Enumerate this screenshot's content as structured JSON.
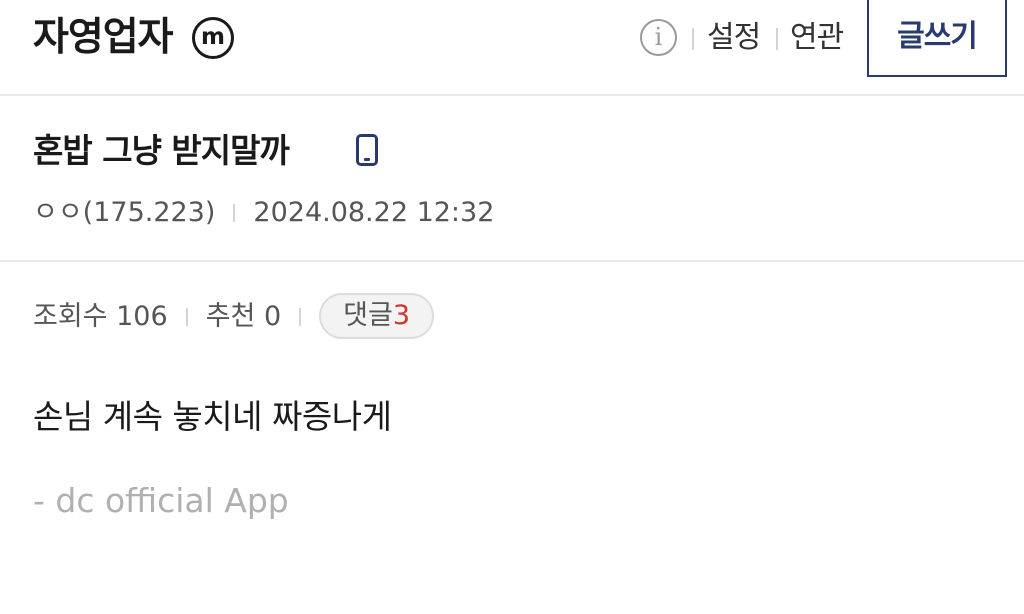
{
  "header": {
    "gallery_title": "자영업자",
    "minor_badge": "m",
    "info_glyph": "i",
    "settings_label": "설정",
    "related_label": "연관",
    "write_label": "글쓰기"
  },
  "post": {
    "title": "혼밥 그냥 받지말까",
    "author": "ㅇㅇ(175.223)",
    "datetime": "2024.08.22 12:32",
    "views_label": "조회수",
    "views": "106",
    "recommend_label": "추천",
    "recommend": "0",
    "comment_label": "댓글",
    "comment_count": "3",
    "body": "손님 계속 놓치네 짜증나게",
    "signature": "- dc official App"
  },
  "colors": {
    "accent_navy": "#2a3a6e",
    "comment_count_red": "#d0342c",
    "muted_gray": "#b0b0b0"
  },
  "icons": {
    "minor_gallery": "minor-gallery-badge-icon",
    "info": "info-icon",
    "mobile": "mobile-device-icon"
  }
}
